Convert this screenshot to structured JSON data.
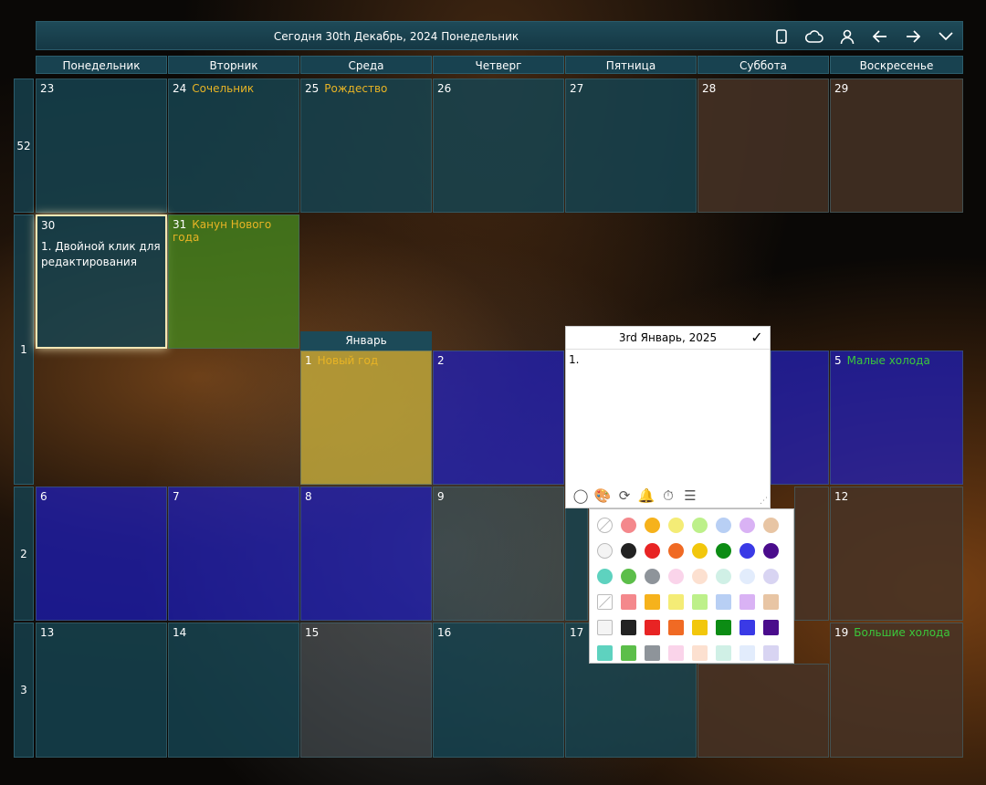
{
  "header": {
    "title": "Сегодня 30th Декабрь, 2024 Понедельник",
    "icons": [
      "phone-icon",
      "cloud-icon",
      "user-icon",
      "arrow-left-icon",
      "arrow-right-icon",
      "chevron-down-icon"
    ]
  },
  "weekdays": [
    "Понедельник",
    "Вторник",
    "Среда",
    "Четверг",
    "Пятница",
    "Суббота",
    "Воскресенье"
  ],
  "weeks": [
    "52",
    "1",
    "2",
    "3"
  ],
  "days": {
    "d23": "23",
    "d24": "24",
    "d25": "25",
    "d26": "26",
    "d27": "27",
    "d28": "28",
    "d29": "29",
    "d30": "30",
    "d31": "31",
    "d1": "1",
    "d2": "2",
    "d5": "5",
    "d6": "6",
    "d7": "7",
    "d8": "8",
    "d9": "9",
    "d12": "12",
    "d13": "13",
    "d14": "14",
    "d15": "15",
    "d16": "16",
    "d17": "17",
    "d19": "19"
  },
  "holidays": {
    "h24": "Сочельник",
    "h25": "Рождество",
    "h31": "Канун Нового года",
    "h1": "Новый год",
    "h5": "Малые холода",
    "h19": "Большие холода"
  },
  "events": {
    "e30": "1. Двойной клик для редактирования"
  },
  "month_label": "Январь",
  "editor": {
    "date": "3rd Январь, 2025",
    "text": "1."
  },
  "palette": {
    "rows": [
      {
        "shape": "circle",
        "first": "none",
        "colors": [
          "#f4888c",
          "#f6b21c",
          "#f4ec76",
          "#bdf08a",
          "#b8cff4",
          "#d9b2f4",
          "#e8c5a4"
        ]
      },
      {
        "shape": "circle",
        "first": "pattern",
        "colors": [
          "#222222",
          "#e82424",
          "#f06a24",
          "#f2c70c",
          "#0c8c14",
          "#3a3ae6",
          "#4a0c8c"
        ]
      },
      {
        "shape": "circle",
        "first": "",
        "colors": [
          "#5ed2bf",
          "#5cbe4a",
          "#8e949a",
          "#fad4ea",
          "#fce0d0",
          "#d0f0e6",
          "#e2ecfc",
          "#d8d4f2"
        ]
      },
      {
        "shape": "square",
        "first": "none",
        "colors": [
          "#f4888c",
          "#f6b21c",
          "#f4ec76",
          "#bdf08a",
          "#b8cff4",
          "#d9b2f4",
          "#e8c5a4"
        ]
      },
      {
        "shape": "square",
        "first": "pattern",
        "colors": [
          "#222222",
          "#e82424",
          "#f06a24",
          "#f2c70c",
          "#0c8c14",
          "#3a3ae6",
          "#4a0c8c"
        ]
      },
      {
        "shape": "square",
        "first": "",
        "colors": [
          "#5ed2bf",
          "#5cbe4a",
          "#8e949a",
          "#fad4ea",
          "#fce0d0",
          "#d0f0e6",
          "#e2ecfc",
          "#d8d4f2"
        ]
      }
    ]
  }
}
